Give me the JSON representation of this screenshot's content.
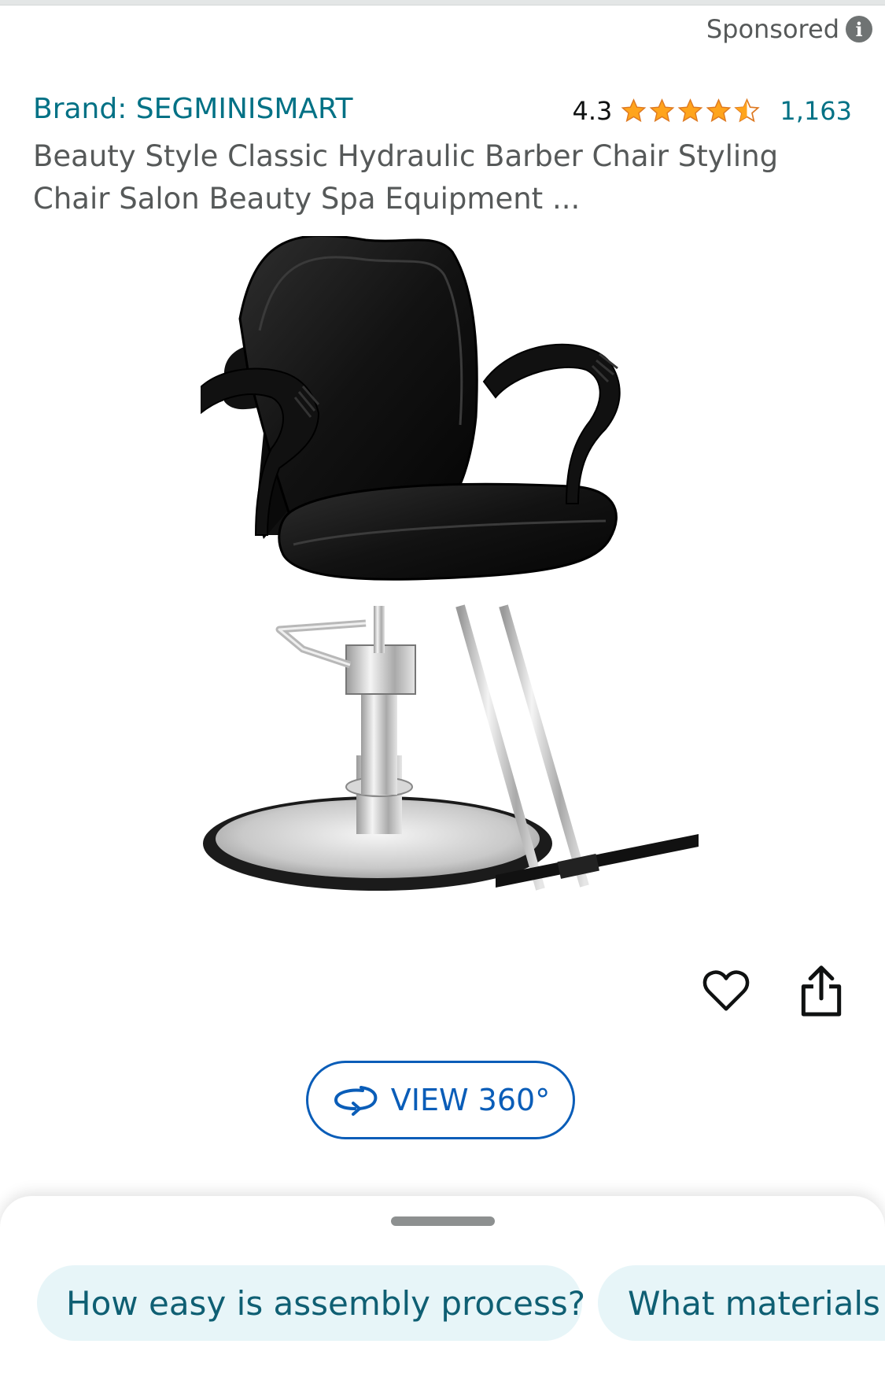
{
  "sponsored": {
    "label": "Sponsored",
    "icon": "info-icon"
  },
  "product": {
    "brand_line": "Brand: SEGMINISMART",
    "rating_value": "4.3",
    "stars": 4.3,
    "review_count": "1,163",
    "title": "Beauty Style Classic Hydraulic Barber Chair Styling Chair Salon Beauty Spa Equipment ...",
    "image_icon": "barber-chair-image"
  },
  "actions": {
    "wishlist_icon": "heart-icon",
    "share_icon": "share-icon"
  },
  "view360": {
    "label": "VIEW 360°",
    "icon": "rotate-360-icon"
  },
  "questions": [
    "How easy is assembly process?",
    "What materials a"
  ],
  "colors": {
    "link": "#007185",
    "star": "#ffa41c",
    "view360": "#0a5db8",
    "chip_bg": "#e7f5f8"
  }
}
